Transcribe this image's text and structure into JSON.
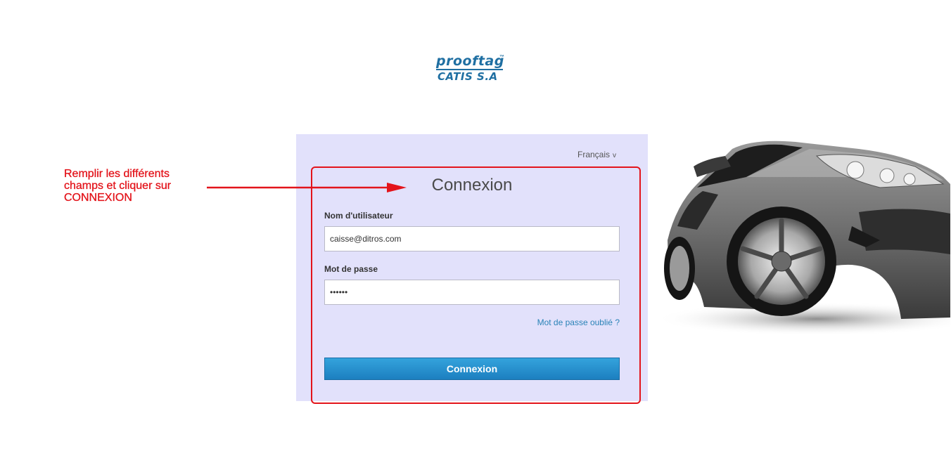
{
  "logo": {
    "brand_top": "prooftag",
    "tm": "™",
    "brand_bottom": "CATIS S.A"
  },
  "language": {
    "selected": "Français",
    "chevron": "v"
  },
  "login": {
    "title": "Connexion",
    "username_label": "Nom d'utilisateur",
    "username_value": "caisse@ditros.com",
    "password_label": "Mot de passe",
    "password_value": "••••••",
    "forgot_link": "Mot de passe oublié ?",
    "submit_label": "Connexion"
  },
  "annotation": {
    "text": "Remplir les différents champs et cliquer sur CONNEXION",
    "color": "#e3141b"
  },
  "colors": {
    "panel_bg": "#e2e1fb",
    "button": "#1c7fc0",
    "brand": "#1f6fa2",
    "link": "#2a83b7"
  },
  "icons": {
    "arrow": "arrow-right-icon",
    "car": "car-photo"
  }
}
